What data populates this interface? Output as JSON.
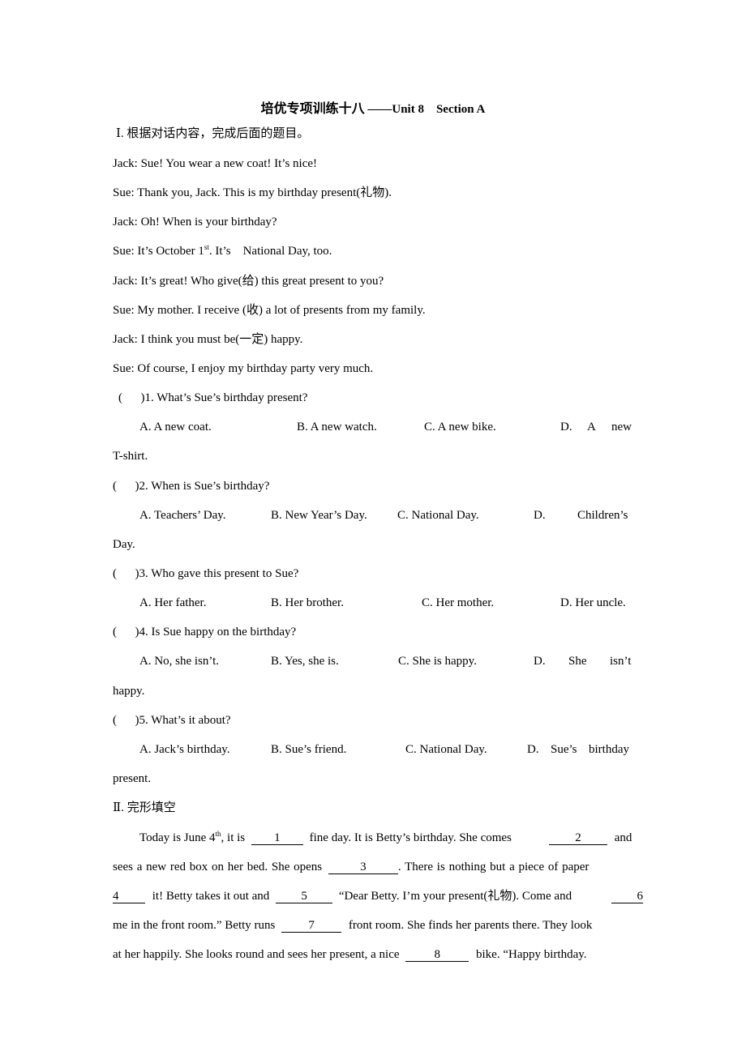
{
  "title": {
    "cn": "培优专项训练十八",
    "dash": " ——",
    "en": "Unit 8    Section A"
  },
  "section1": {
    "heading": "Ⅰ. 根据对话内容，完成后面的题目。",
    "dialogue": [
      "Jack: Sue! You wear a new coat! It’s nice!",
      "Sue: Thank you, Jack. This is my birthday present(礼物).",
      "Jack: Oh! When is your birthday?",
      {
        "pre": "Sue: It’s October 1",
        "sup": "st",
        "post": ". It’s    National Day, too."
      },
      "Jack: It’s great! Who give(给) this great present to you?",
      "Sue: My mother. I receive (收) a lot of presents from my family.",
      "Jack: I think you must be(一定) happy.",
      "Sue: Of course, I enjoy my birthday party very much."
    ],
    "questions": [
      {
        "stem": "(      )1. What’s Sue’s birthday present?",
        "options": [
          "A. A new coat.",
          "B. A new watch.",
          "C. A new bike.",
          "D.",
          "A",
          "new"
        ],
        "wrap": "T-shirt."
      },
      {
        "stem": "(      )2. When is Sue’s birthday?",
        "options": [
          "A. Teachers’ Day.",
          "B. New Year’s Day.",
          "C. National Day.",
          "D.",
          "Children’s"
        ],
        "wrap": "Day."
      },
      {
        "stem": "(      )3. Who gave this present to Sue?",
        "options": [
          "A. Her father.",
          "B. Her brother.",
          "C. Her mother.",
          "D. Her uncle."
        ]
      },
      {
        "stem": "(      )4. Is Sue happy on the birthday?",
        "options": [
          "A. No, she isn’t.",
          "B. Yes, she is.",
          "C. She is happy.",
          "D.",
          "She",
          "isn’t"
        ],
        "wrap": "happy."
      },
      {
        "stem": "(      )5. What’s it about?",
        "options": [
          "A. Jack’s birthday.",
          "B. Sue’s friend.",
          "C. National Day.",
          "D.",
          "Sue’s",
          "birthday"
        ],
        "wrap": "present."
      }
    ]
  },
  "section2": {
    "heading": "Ⅱ. 完形填空",
    "passage": {
      "l1": {
        "a": "Today is June 4",
        "sup": "th",
        "b": ", it is",
        "b1": "1",
        "c": "fine day. It is Betty’s birthday. She comes",
        "b2": "2",
        "d": "and"
      },
      "l2": {
        "a": "sees a new red box on her bed. She opens",
        "b3": "3",
        "b": ". There is nothing but a piece of paper"
      },
      "l3": {
        "b4": "4",
        "a": "it! Betty takes it out and",
        "b5": "5",
        "b": "“Dear Betty. I’m your present(礼物). Come and",
        "b6": "6"
      },
      "l4": {
        "a": "me in the front room.” Betty runs",
        "b7": "7",
        "b": "front room. She finds her parents there. They look"
      },
      "l5": {
        "a": "at her happily. She looks round and sees her present, a nice",
        "b8": "8",
        "b": "bike. “Happy birthday."
      }
    }
  }
}
